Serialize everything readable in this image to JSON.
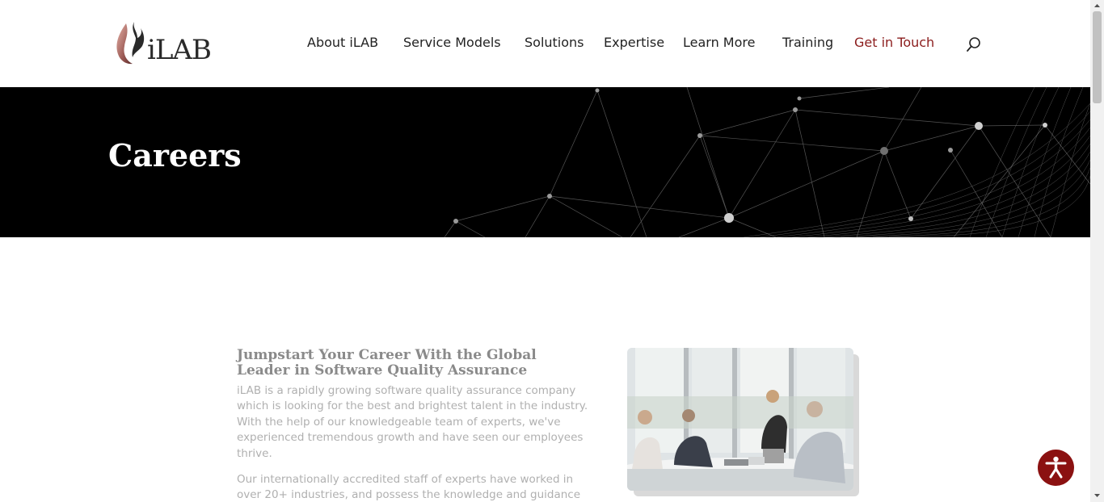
{
  "header": {
    "logo_text": "iLAB",
    "nav": [
      {
        "label": "About iLAB"
      },
      {
        "label": "Service Models"
      },
      {
        "label": "Solutions"
      },
      {
        "label": "Expertise"
      },
      {
        "label": "Learn More"
      },
      {
        "label": "Training"
      },
      {
        "label": "Get in Touch"
      }
    ],
    "search_icon": "search-icon"
  },
  "hero": {
    "title": "Careers"
  },
  "content": {
    "heading": "Jumpstart Your Career With the Global Leader in Software Quality Assurance",
    "paragraph1": "iLAB is a rapidly growing software quality assurance company which is looking for the best and brightest talent in the industry. With the help of our knowledgeable team of experts, we've experienced tremendous growth and have seen our employees thrive.",
    "paragraph2": "Our internationally accredited staff of experts have worked in over 20+ industries, and possess the knowledge and guidance that can"
  },
  "accessibility": {
    "icon": "accessibility-icon"
  },
  "colors": {
    "brand": "#8b1c1c",
    "accessibility_bg": "#8b1111",
    "hero_bg": "#000000"
  }
}
